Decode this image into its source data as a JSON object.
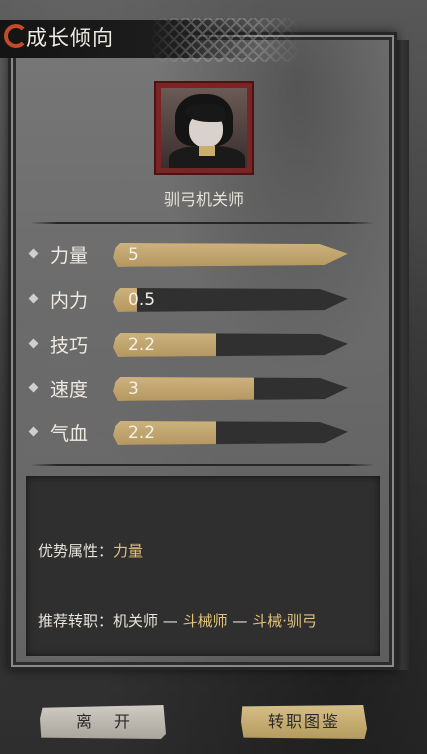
{
  "header": {
    "title": "成长倾向"
  },
  "character": {
    "name": "驯弓机关师"
  },
  "stats": [
    {
      "label": "力量",
      "value": "5",
      "fill": 1.0
    },
    {
      "label": "内力",
      "value": "0.5",
      "fill": 0.1
    },
    {
      "label": "技巧",
      "value": "2.2",
      "fill": 0.44
    },
    {
      "label": "速度",
      "value": "3",
      "fill": 0.6
    },
    {
      "label": "气血",
      "value": "2.2",
      "fill": 0.44
    }
  ],
  "info": {
    "advantage_label": "优势属性：",
    "advantage_value": "力量",
    "recommend_label": "推荐转职：",
    "path_start": "机关师",
    "sep1": " — ",
    "path_mid": "斗械师",
    "sep2": " — ",
    "path_end": "斗械·驯弓"
  },
  "buttons": {
    "leave": "离开",
    "guide": "转职图鉴"
  },
  "colors": {
    "accent_gold": "#e3c37a",
    "bar_fill": "#c2a46c",
    "portrait_frame": "#7a2426"
  }
}
